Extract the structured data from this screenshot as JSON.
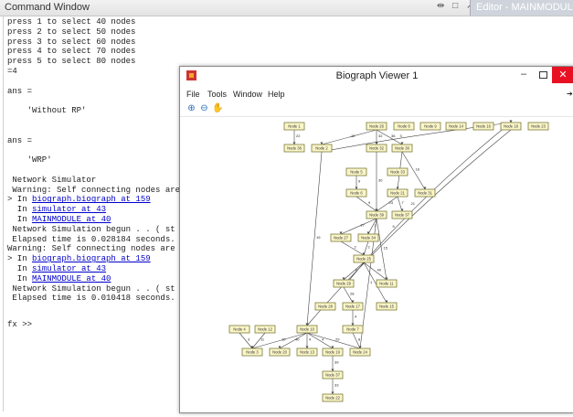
{
  "command_window": {
    "title": "Command Window",
    "editor_tab": "Editor - MAINMODULE",
    "lines": [
      {
        "text": "press 1 to select 40 nodes"
      },
      {
        "text": "press 2 to select 50 nodes"
      },
      {
        "text": "press 3 to select 60 nodes"
      },
      {
        "text": "press 4 to select 70 nodes"
      },
      {
        "text": "press 5 to select 80 nodes"
      },
      {
        "text": "=4"
      },
      {
        "text": ""
      },
      {
        "text": "ans ="
      },
      {
        "text": ""
      },
      {
        "text": "    'Without RP'"
      },
      {
        "text": ""
      },
      {
        "text": ""
      },
      {
        "text": "ans ="
      },
      {
        "text": ""
      },
      {
        "text": "    'WRP'"
      },
      {
        "text": ""
      },
      {
        "text": " Network Simulator"
      },
      {
        "text": " Warning: Self connecting nodes are"
      },
      {
        "text": "> In ",
        "link": "biograph.biograph at 159"
      },
      {
        "text": "  In ",
        "link": "simulator at 43"
      },
      {
        "text": "  In ",
        "link": "MAINMODULE at 40"
      },
      {
        "text": " Network Simulation begun . . ( st"
      },
      {
        "text": " Elapsed time is 0.028184 seconds."
      },
      {
        "text": "Warning: Self connecting nodes are"
      },
      {
        "text": "> In ",
        "link": "biograph.biograph at 159"
      },
      {
        "text": "  In ",
        "link": "simulator at 43"
      },
      {
        "text": "  In ",
        "link": "MAINMODULE at 40"
      },
      {
        "text": " Network Simulation begun . . ( st"
      },
      {
        "text": " Elapsed time is 0.010418 seconds."
      }
    ],
    "prompt": "fx >>"
  },
  "biograph_viewer": {
    "title": "Biograph Viewer 1",
    "menu": [
      "File",
      "Tools",
      "Window",
      "Help"
    ],
    "toolbar": {
      "zoom_in": "zoom-in-icon",
      "zoom_out": "zoom-out-icon",
      "pan": "hand-icon"
    },
    "graph": {
      "nodes": [
        {
          "id": "n1",
          "label": "Node 1"
        },
        {
          "id": "n26",
          "label": "Node 26"
        },
        {
          "id": "n8",
          "label": "Node 8"
        },
        {
          "id": "n9",
          "label": "Node 9"
        },
        {
          "id": "n14",
          "label": "Node 14"
        },
        {
          "id": "n16",
          "label": "Node 16"
        },
        {
          "id": "n18",
          "label": "Node 18"
        },
        {
          "id": "n23",
          "label": "Node 23"
        },
        {
          "id": "n36",
          "label": "Node 36"
        },
        {
          "id": "n2",
          "label": "Node 2"
        },
        {
          "id": "n32",
          "label": "Node 32"
        },
        {
          "id": "n30",
          "label": "Node 30"
        },
        {
          "id": "n5",
          "label": "Node 5"
        },
        {
          "id": "n33",
          "label": "Node 33"
        },
        {
          "id": "n6",
          "label": "Node 6"
        },
        {
          "id": "n21",
          "label": "Node 21"
        },
        {
          "id": "n31",
          "label": "Node 31"
        },
        {
          "id": "n37",
          "label": "Node 37"
        },
        {
          "id": "n39",
          "label": "Node 39"
        },
        {
          "id": "n27",
          "label": "Node 27"
        },
        {
          "id": "n34",
          "label": "Node 34"
        },
        {
          "id": "n25",
          "label": "Node 25"
        },
        {
          "id": "n29",
          "label": "Node 29"
        },
        {
          "id": "n11",
          "label": "Node 11"
        },
        {
          "id": "n15",
          "label": "Node 15"
        },
        {
          "id": "n17",
          "label": "Node 17"
        },
        {
          "id": "n28",
          "label": "Node 28"
        },
        {
          "id": "n7",
          "label": "Node 7"
        },
        {
          "id": "n4",
          "label": "Node 4"
        },
        {
          "id": "n12",
          "label": "Node 12"
        },
        {
          "id": "n10",
          "label": "Node 10"
        },
        {
          "id": "n3",
          "label": "Node 3"
        },
        {
          "id": "n20",
          "label": "Node 20"
        },
        {
          "id": "n13",
          "label": "Node 13"
        },
        {
          "id": "n19",
          "label": "Node 19"
        },
        {
          "id": "n24",
          "label": "Node 24"
        },
        {
          "id": "n37b",
          "label": "Node 37"
        },
        {
          "id": "n22",
          "label": "Node 22"
        }
      ],
      "edges": [
        {
          "from": "n1",
          "to": "n36",
          "label": "22"
        },
        {
          "from": "n26",
          "to": "n2",
          "label": "12"
        },
        {
          "from": "n26",
          "to": "n32",
          "label": "32"
        },
        {
          "from": "n26",
          "to": "n30",
          "label": "36"
        },
        {
          "from": "n30",
          "to": "n21",
          "label": "16"
        },
        {
          "from": "n30",
          "to": "n31",
          "label": "16"
        },
        {
          "from": "n32",
          "to": "n39",
          "label": "30"
        },
        {
          "from": "n5",
          "to": "n6",
          "label": "9"
        },
        {
          "from": "n6",
          "to": "n39",
          "label": "9"
        },
        {
          "from": "n21",
          "to": "n39",
          "label": "23"
        },
        {
          "from": "n21",
          "to": "n37",
          "label": "7"
        },
        {
          "from": "n2",
          "to": "n18",
          "label": "3"
        },
        {
          "from": "n2",
          "to": "n10",
          "label": "19"
        },
        {
          "from": "n39",
          "to": "n27",
          "label": "27"
        },
        {
          "from": "n39",
          "to": "n34",
          "label": "3"
        },
        {
          "from": "n39",
          "to": "n11",
          "label": "15"
        },
        {
          "from": "n39",
          "to": "n24",
          "label": "1"
        },
        {
          "from": "n27",
          "to": "n25",
          "label": "2"
        },
        {
          "from": "n34",
          "to": "n25",
          "label": "2"
        },
        {
          "from": "n25",
          "to": "n29",
          "label": "6"
        },
        {
          "from": "n25",
          "to": "n11",
          "label": "40"
        },
        {
          "from": "n25",
          "to": "n15",
          "label": "20"
        },
        {
          "from": "n29",
          "to": "n18",
          "label": "21"
        },
        {
          "from": "n29",
          "to": "n17",
          "label": "28"
        },
        {
          "from": "n17",
          "to": "n7",
          "label": "4"
        },
        {
          "from": "n18",
          "to": "n10",
          "label": "5"
        },
        {
          "from": "n4",
          "to": "n3",
          "label": "3"
        },
        {
          "from": "n12",
          "to": "n3",
          "label": "11"
        },
        {
          "from": "n10",
          "to": "n3",
          "label": "10"
        },
        {
          "from": "n10",
          "to": "n20",
          "label": "40"
        },
        {
          "from": "n10",
          "to": "n13",
          "label": "4"
        },
        {
          "from": "n10",
          "to": "n19",
          "label": "4"
        },
        {
          "from": "n10",
          "to": "n24",
          "label": "29"
        },
        {
          "from": "n7",
          "to": "n24",
          "label": "8"
        },
        {
          "from": "n19",
          "to": "n37b",
          "label": "39"
        },
        {
          "from": "n37b",
          "to": "n22",
          "label": "33"
        }
      ]
    }
  }
}
